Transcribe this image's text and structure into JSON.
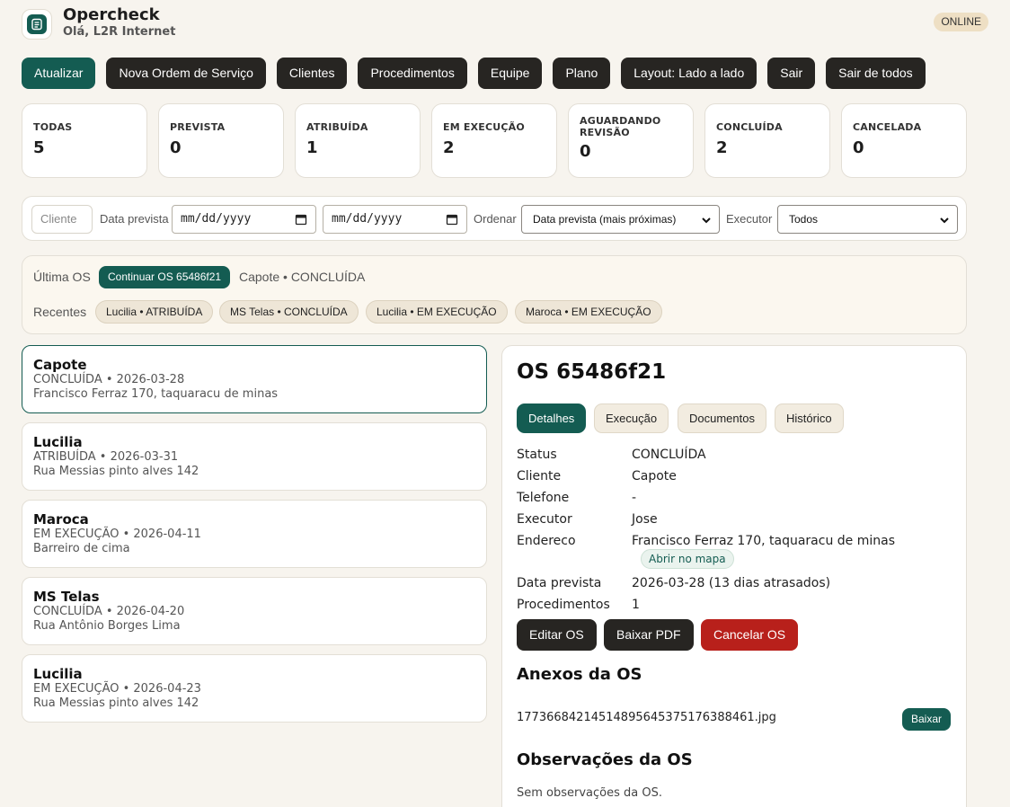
{
  "header": {
    "app_title": "Opercheck",
    "greeting": "Olá, L2R Internet",
    "status_badge": "ONLINE"
  },
  "toolbar": {
    "refresh": "Atualizar",
    "new_order": "Nova Ordem de Serviço",
    "clients": "Clientes",
    "procedures": "Procedimentos",
    "team": "Equipe",
    "plan": "Plano",
    "layout": "Layout: Lado a lado",
    "logout": "Sair",
    "logout_all": "Sair de todos"
  },
  "stats": [
    {
      "label": "TODAS",
      "value": "5"
    },
    {
      "label": "PREVISTA",
      "value": "0"
    },
    {
      "label": "ATRIBUÍDA",
      "value": "1"
    },
    {
      "label": "EM EXECUÇÃO",
      "value": "2"
    },
    {
      "label": "AGUARDANDO REVISÃO",
      "value": "0"
    },
    {
      "label": "CONCLUÍDA",
      "value": "2"
    },
    {
      "label": "CANCELADA",
      "value": "0"
    }
  ],
  "filters": {
    "client_placeholder": "Cliente",
    "date_label": "Data prevista",
    "date_from": "mm/dd/yyyy",
    "date_to": "mm/dd/yyyy",
    "order_label": "Ordenar",
    "order_value": "Data prevista (mais próximas)",
    "executor_label": "Executor",
    "executor_value": "Todos"
  },
  "recent": {
    "last_label": "Última OS",
    "continue_button": "Continuar OS 65486f21",
    "last_info": "Capote • CONCLUÍDA",
    "recent_label": "Recentes",
    "chips": [
      "Lucilia • ATRIBUÍDA",
      "MS Telas • CONCLUÍDA",
      "Lucilia • EM EXECUÇÃO",
      "Maroca • EM EXECUÇÃO"
    ]
  },
  "orders": [
    {
      "name": "Capote",
      "meta": "CONCLUÍDA • 2026-03-28",
      "address": "Francisco Ferraz 170, taquaracu de minas"
    },
    {
      "name": "Lucilia",
      "meta": "ATRIBUÍDA • 2026-03-31",
      "address": "Rua Messias pinto alves 142"
    },
    {
      "name": "Maroca",
      "meta": "EM EXECUÇÃO • 2026-04-11",
      "address": "Barreiro de cima"
    },
    {
      "name": "MS Telas",
      "meta": "CONCLUÍDA • 2026-04-20",
      "address": "Rua Antônio Borges Lima"
    },
    {
      "name": "Lucilia",
      "meta": "EM EXECUÇÃO • 2026-04-23",
      "address": "Rua Messias pinto alves 142"
    }
  ],
  "detail": {
    "title": "OS 65486f21",
    "tabs": [
      "Detalhes",
      "Execução",
      "Documentos",
      "Histórico"
    ],
    "rows": [
      {
        "label": "Status",
        "value": "CONCLUÍDA"
      },
      {
        "label": "Cliente",
        "value": "Capote"
      },
      {
        "label": "Telefone",
        "value": "-"
      },
      {
        "label": "Executor",
        "value": "Jose"
      },
      {
        "label": "Endereco",
        "value": "Francisco Ferraz 170, taquaracu de minas"
      },
      {
        "label": "Data prevista",
        "value": "2026-03-28 (13 dias atrasados)"
      },
      {
        "label": "Procedimentos",
        "value": "1"
      }
    ],
    "map_link": "Abrir no mapa",
    "edit_button": "Editar OS",
    "pdf_button": "Baixar PDF",
    "cancel_button": "Cancelar OS",
    "attachments_title": "Anexos da OS",
    "attachment_name": "17736684214514895645375176388461.jpg",
    "download_button": "Baixar",
    "notes_title": "Observações da OS",
    "notes_text": "Sem observações da OS."
  },
  "colors": {
    "accent": "#145c52",
    "dark_button": "#272522",
    "danger": "#b8201b",
    "background": "#f7f4ee"
  }
}
